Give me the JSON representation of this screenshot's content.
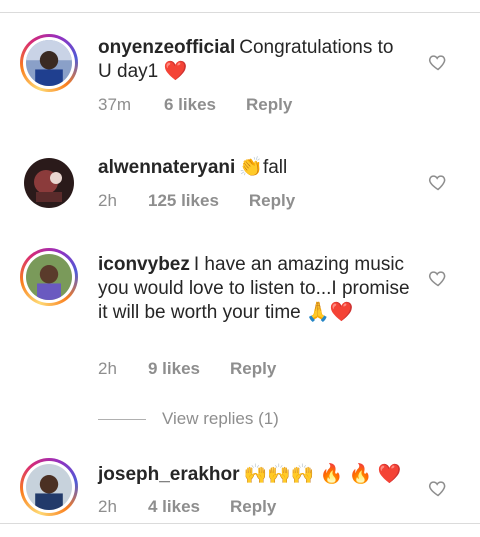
{
  "comments": [
    {
      "username": "onyenzeofficial",
      "text": "Congratulations to U day1",
      "emoji": "❤️",
      "time": "37m",
      "likes": "6 likes",
      "reply": "Reply"
    },
    {
      "username": "alwennateryani",
      "text": "fall",
      "emoji_before": "👏",
      "time": "2h",
      "likes": "125 likes",
      "reply": "Reply"
    },
    {
      "username": "iconvybez",
      "text": "I have an amazing music you would love to listen to...I promise it will be worth your time",
      "emoji": "🙏❤️",
      "time": "2h",
      "likes": "9 likes",
      "reply": "Reply",
      "view_replies": "View replies (1)"
    },
    {
      "username": "joseph_erakhor",
      "emoji": "🙌🙌🙌 🔥 🔥 ❤️",
      "time": "2h",
      "likes": "4 likes",
      "reply": "Reply"
    }
  ],
  "icons": {
    "like": "heart-outline-icon"
  },
  "colors": {
    "text": "#262626",
    "meta": "#8e8e8e",
    "divider": "#dbdbdb"
  }
}
